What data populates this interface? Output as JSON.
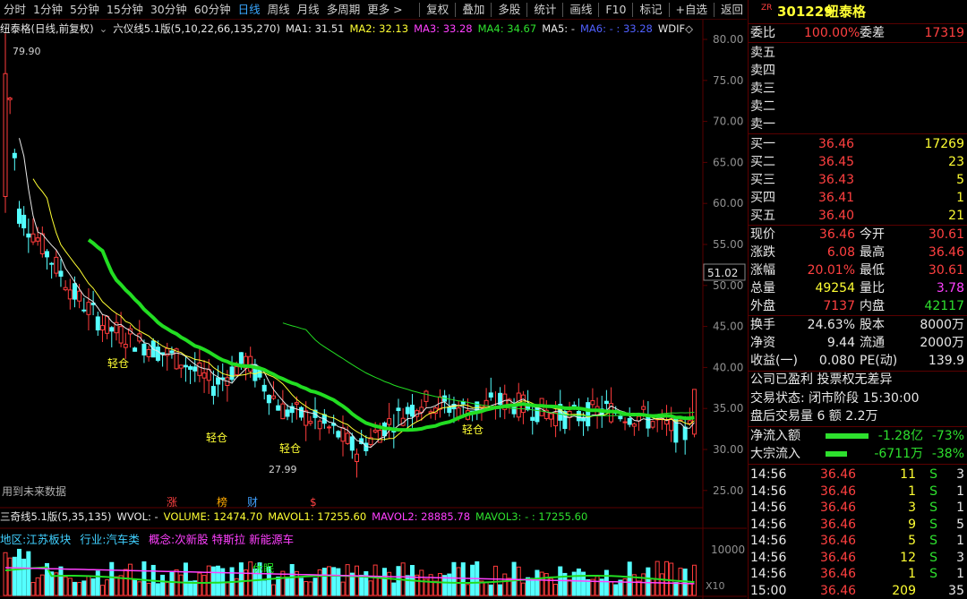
{
  "toolbar": {
    "left": [
      "分时",
      "1分钟",
      "5分钟",
      "15分钟",
      "30分钟",
      "60分钟",
      "日线",
      "周线",
      "月线",
      "多周期",
      "更多 >"
    ],
    "active_index": 6,
    "right": [
      "复权",
      "叠加",
      "多股",
      "统计",
      "画线",
      "F10",
      "标记",
      "+自选",
      "返回"
    ]
  },
  "stock": {
    "prefix": "ZR",
    "code": "301229",
    "name": "纽泰格"
  },
  "info": {
    "title": "纽泰格(日线,前复权)",
    "indicator": "六仪线5.1版(5,10,22,66,135,270)",
    "ma1": "MA1: 31.51",
    "ma2": "MA2: 32.13",
    "ma3": "MA3: 33.28",
    "ma4": "MA4: 34.67",
    "ma5": "MA5: -",
    "ma6": "MA6: - : 33.28",
    "wdif": "WDIF◇"
  },
  "price_axis": [
    "80.00",
    "75.00",
    "70.00",
    "65.00",
    "60.00",
    "55.00",
    "50.00",
    "45.00",
    "40.00",
    "35.00",
    "30.00",
    "25.00"
  ],
  "current_axis_label": "51.02",
  "annotations": {
    "high": "79.90",
    "low": "27.99",
    "light1": "轻仓",
    "light2": "轻仓",
    "light3": "轻仓",
    "light4": "轻仓",
    "future_note": "用到未来数据",
    "ev_zhang": "涨",
    "ev_bang": "榜",
    "ev_cai": "财",
    "ev_s": "$"
  },
  "volume": {
    "indicator": "三奇线5.1版(5,35,135)",
    "wvol": "WVOL: -",
    "volume": "VOLUME: 12474.70",
    "mavol1": "MAVOL1: 17255.60",
    "mavol2": "MAVOL2: 28885.78",
    "mavol3": "MAVOL3: - : 17255.60",
    "axis": "10000",
    "unit": "X10",
    "xiumian": "休眠"
  },
  "tags": {
    "region": "地区:江苏板块",
    "industry": "行业:汽车类",
    "concept": "概念:次新股 特斯拉 新能源车"
  },
  "bidask": {
    "weibi_label": "委比",
    "weibi": "100.00%",
    "weicha_label": "委差",
    "weicha": "17319",
    "sells": [
      "卖五",
      "卖四",
      "卖三",
      "卖二",
      "卖一"
    ],
    "buys": [
      {
        "label": "买一",
        "price": "36.46",
        "vol": "17269"
      },
      {
        "label": "买二",
        "price": "36.45",
        "vol": "23"
      },
      {
        "label": "买三",
        "price": "36.43",
        "vol": "5"
      },
      {
        "label": "买四",
        "price": "36.41",
        "vol": "1"
      },
      {
        "label": "买五",
        "price": "36.40",
        "vol": "21"
      }
    ]
  },
  "quote": [
    {
      "l1": "现价",
      "v1": "36.46",
      "c1": "red",
      "l2": "今开",
      "v2": "30.61",
      "c2": "red"
    },
    {
      "l1": "涨跌",
      "v1": "6.08",
      "c1": "red",
      "l2": "最高",
      "v2": "36.46",
      "c2": "red"
    },
    {
      "l1": "涨幅",
      "v1": "20.01%",
      "c1": "red",
      "l2": "最低",
      "v2": "30.61",
      "c2": "red"
    },
    {
      "l1": "总量",
      "v1": "49254",
      "c1": "yel",
      "l2": "量比",
      "v2": "3.78",
      "c2": "mag"
    },
    {
      "l1": "外盘",
      "v1": "7137",
      "c1": "red",
      "l2": "内盘",
      "v2": "42117",
      "c2": "grn"
    }
  ],
  "finance": [
    {
      "l1": "换手",
      "v1": "24.63%",
      "l2": "股本",
      "v2": "8000万"
    },
    {
      "l1": "净资",
      "v1": "9.44",
      "l2": "流通",
      "v2": "2000万"
    },
    {
      "l1": "收益(一)",
      "v1": "0.080",
      "l2": "PE(动)",
      "v2": "139.9"
    }
  ],
  "status": {
    "profit": "公司已盈利 投票权无差异",
    "trade_state": "交易状态: 闭市阶段 15:30:00",
    "after": "盘后交易量 6 额 2.2万"
  },
  "flows": [
    {
      "label": "净流入额",
      "value": "-1.28亿",
      "pct": "-73%"
    },
    {
      "label": "大宗流入",
      "value": "-6711万",
      "pct": "-38%"
    }
  ],
  "ticks": [
    {
      "time": "14:56",
      "price": "36.46",
      "vol": "11",
      "side": "S",
      "n": "3"
    },
    {
      "time": "14:56",
      "price": "36.46",
      "vol": "1",
      "side": "S",
      "n": "1"
    },
    {
      "time": "14:56",
      "price": "36.46",
      "vol": "3",
      "side": "S",
      "n": "1"
    },
    {
      "time": "14:56",
      "price": "36.46",
      "vol": "9",
      "side": "S",
      "n": "5"
    },
    {
      "time": "14:56",
      "price": "36.46",
      "vol": "5",
      "side": "S",
      "n": "1"
    },
    {
      "time": "14:56",
      "price": "36.46",
      "vol": "12",
      "side": "S",
      "n": "3"
    },
    {
      "time": "14:56",
      "price": "36.46",
      "vol": "1",
      "side": "S",
      "n": "1"
    },
    {
      "time": "15:00",
      "price": "36.46",
      "vol": "209",
      "side": "",
      "n": "35"
    }
  ],
  "colors": {
    "up": "#ff3c3c",
    "down": "#54ffff",
    "ma_green": "#22dd22",
    "ma_red": "#ff2020",
    "frame": "#5a0000"
  }
}
